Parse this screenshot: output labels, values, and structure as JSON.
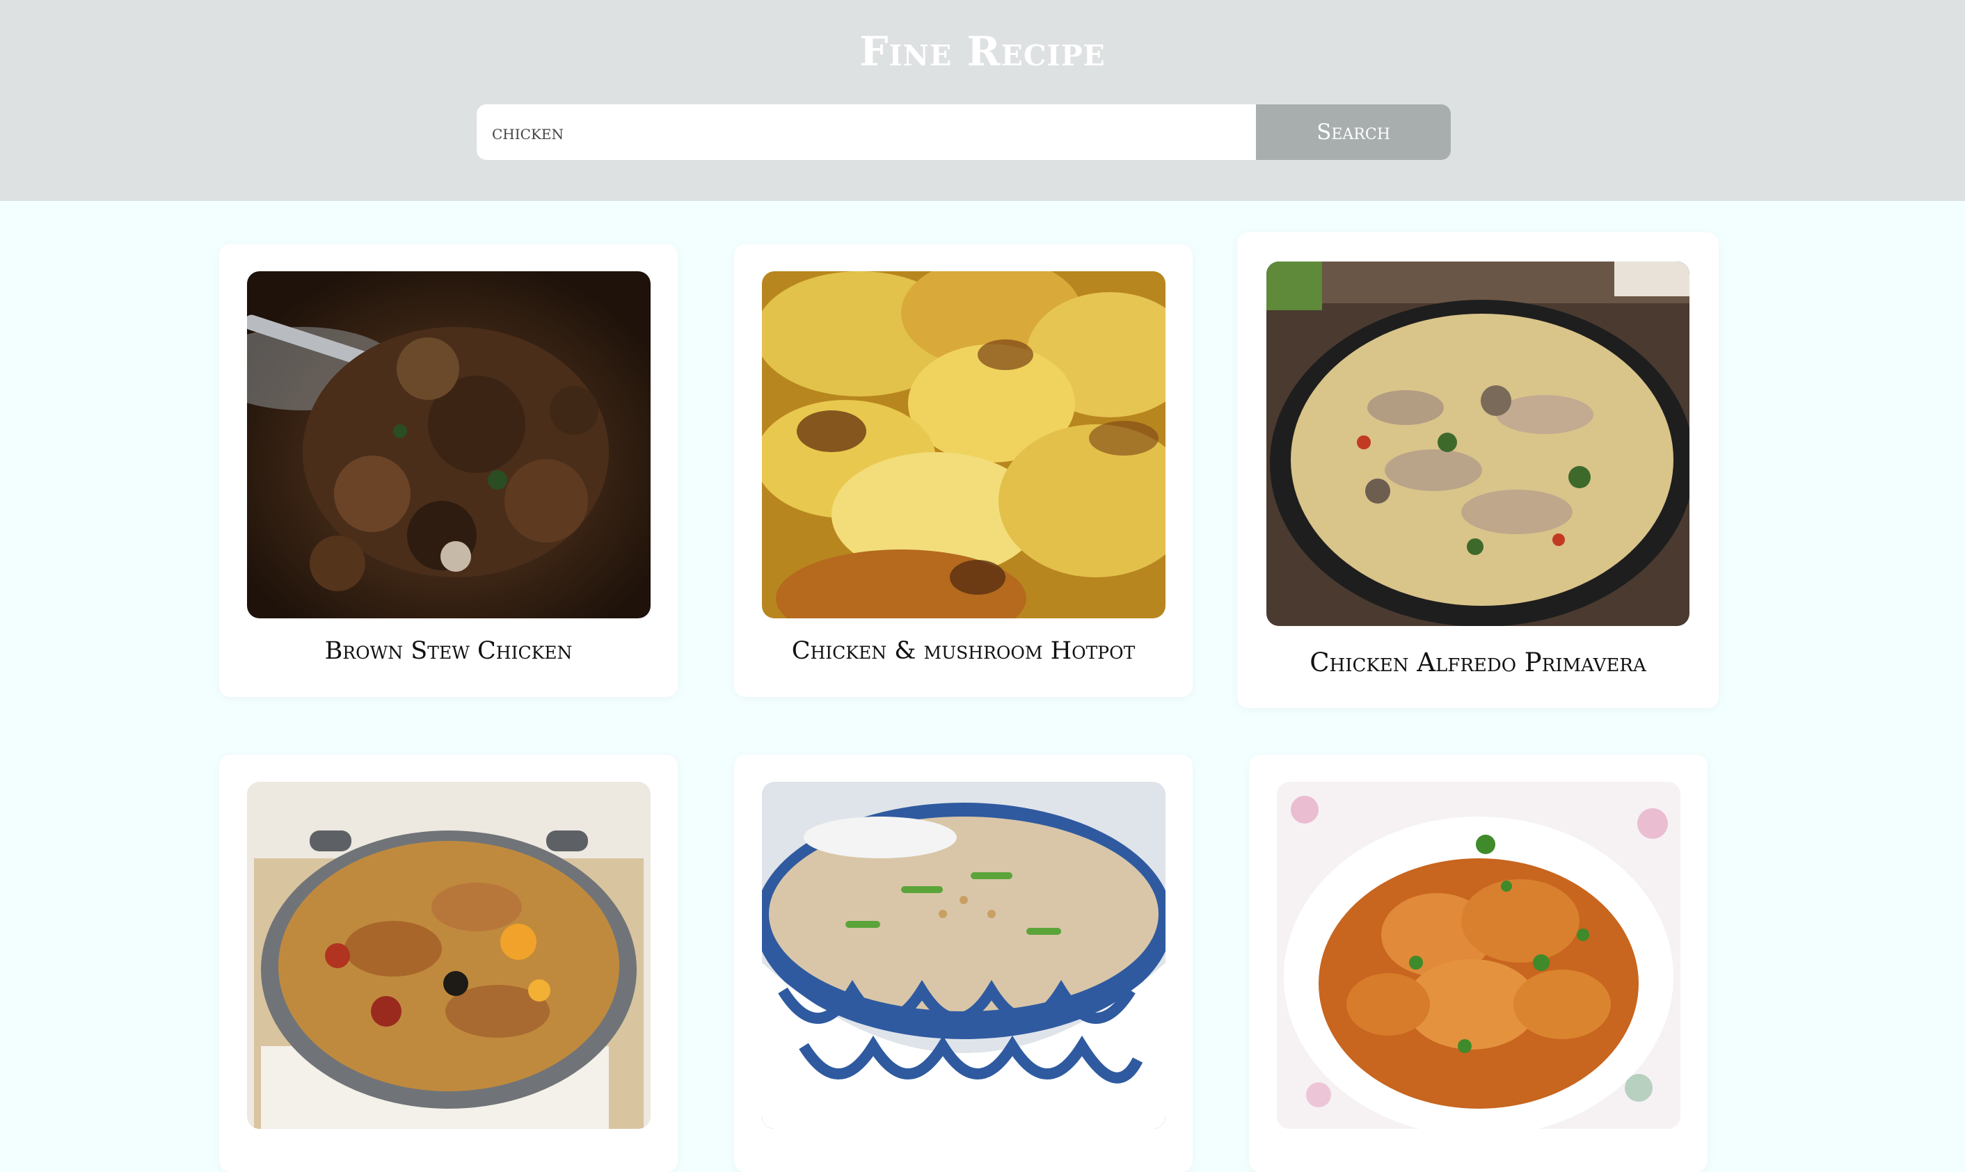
{
  "app": {
    "title": "Fine Recipe"
  },
  "search": {
    "value": "chicken",
    "button_label": "Search"
  },
  "recipes": [
    {
      "title": "Brown Stew Chicken",
      "image_icon": "brown-stew-chicken-photo"
    },
    {
      "title": "Chicken & mushroom Hotpot",
      "image_icon": "chicken-mushroom-hotpot-photo"
    },
    {
      "title": "Chicken Alfredo Primavera",
      "image_icon": "chicken-alfredo-primavera-photo"
    },
    {
      "title": "",
      "image_icon": "chicken-paella-pan-photo"
    },
    {
      "title": "",
      "image_icon": "chicken-congee-bowl-photo"
    },
    {
      "title": "",
      "image_icon": "chicken-curry-plate-photo"
    }
  ],
  "colors": {
    "header_bg": "#dee1e2",
    "page_bg": "#f3fefe",
    "button_bg": "#a8aeae",
    "card_bg": "#ffffff"
  }
}
